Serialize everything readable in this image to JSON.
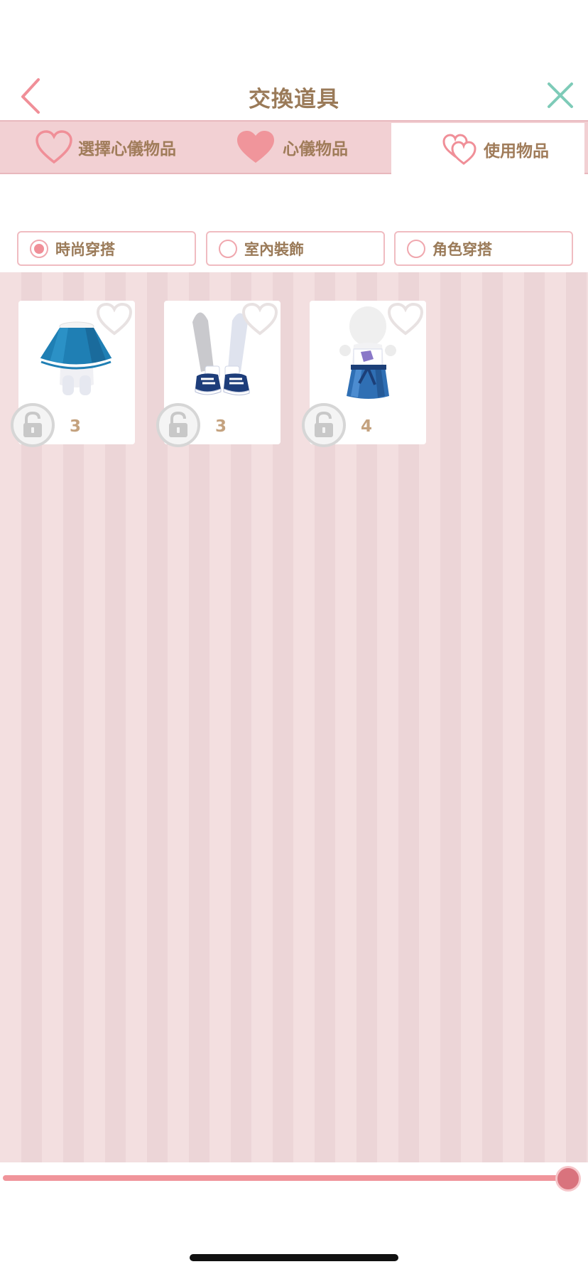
{
  "header": {
    "title": "交換道具"
  },
  "tabs": [
    {
      "label": "選擇心儀物品",
      "icon": "heart-outline-icon"
    },
    {
      "label": "心儀物品",
      "icon": "heart-filled-icon"
    },
    {
      "label": "使用物品",
      "icon": "double-heart-icon",
      "selected": true
    }
  ],
  "filters": [
    {
      "label": "時尚穿搭",
      "selected": true
    },
    {
      "label": "室內裝飾",
      "selected": false
    },
    {
      "label": "角色穿搭",
      "selected": false
    }
  ],
  "items": [
    {
      "count": "3",
      "icon": "blue-skirt-item"
    },
    {
      "count": "3",
      "icon": "sneakers-item"
    },
    {
      "count": "4",
      "icon": "blue-outfit-item"
    }
  ],
  "colors": {
    "accent": "#f08f98",
    "text": "#9a7a58",
    "tab_bg": "#f2d0d3",
    "close": "#7ecbb8"
  }
}
